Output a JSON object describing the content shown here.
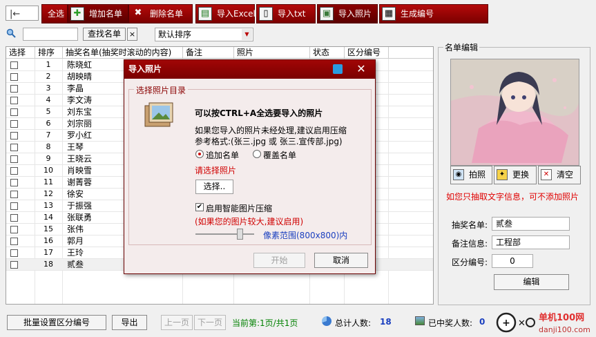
{
  "toolbar": {
    "select_all": "全选",
    "add_list": "增加名单",
    "delete_list": "删除名单",
    "import_excel": "导入Excel",
    "import_txt": "导入txt",
    "import_photo": "导入照片",
    "generate_number": "生成编号"
  },
  "search": {
    "button": "查找名单",
    "clear": "×",
    "sort": "默认排序"
  },
  "table": {
    "headers": [
      "选择",
      "排序",
      "抽奖名单(抽奖时滚动的内容)",
      "备注",
      "照片",
      "状态",
      "区分编号"
    ],
    "rows": [
      {
        "n": "1",
        "name": "陈晓虹"
      },
      {
        "n": "2",
        "name": "胡映晴"
      },
      {
        "n": "3",
        "name": "李晶"
      },
      {
        "n": "4",
        "name": "李文涛"
      },
      {
        "n": "5",
        "name": "刘东宝"
      },
      {
        "n": "6",
        "name": "刘宗丽"
      },
      {
        "n": "7",
        "name": "罗小红"
      },
      {
        "n": "8",
        "name": "王琴"
      },
      {
        "n": "9",
        "name": "王晓云"
      },
      {
        "n": "10",
        "name": "肖映雪"
      },
      {
        "n": "11",
        "name": "谢菁蓉"
      },
      {
        "n": "12",
        "name": "徐安"
      },
      {
        "n": "13",
        "name": "于振强"
      },
      {
        "n": "14",
        "name": "张联勇"
      },
      {
        "n": "15",
        "name": "张伟"
      },
      {
        "n": "16",
        "name": "郭月"
      },
      {
        "n": "17",
        "name": "王玲"
      },
      {
        "n": "18",
        "name": "贰叁"
      }
    ]
  },
  "panel": {
    "title": "名单编辑",
    "take_photo": "拍照",
    "replace": "更换",
    "clear": "清空",
    "note": "如您只抽取文字信息，可不添加照片",
    "name_label": "抽奖名单:",
    "name_value": "贰叁",
    "remark_label": "备注信息:",
    "remark_value": "工程部",
    "code_label": "区分编号:",
    "code_value": "0",
    "edit": "编辑"
  },
  "bottom": {
    "batch": "批量设置区分编号",
    "export": "导出",
    "prev": "上一页",
    "next": "下一页",
    "page": "当前第:1页/共1页",
    "total_label": "总计人数:",
    "total_value": "18",
    "winners_label": "已中奖人数:",
    "winners_value": "0"
  },
  "dialog": {
    "title": "导入照片",
    "group": "选择照片目录",
    "hint_bold": "可以按CTRL+A全选要导入的照片",
    "hint1": "如果您导入的照片未经处理,建议启用压缩",
    "hint2": "参考格式:(张三.jpg 或 张三.宣传部.jpg)",
    "opt_append": "追加名单",
    "opt_overwrite": "覆盖名单",
    "select_prompt": "请选择照片",
    "select_btn": "选择..",
    "compress_label": "启用智能图片压缩",
    "compress_note": "(如果您的图片较大,建议启用)",
    "pixel_range": "像素范围(800x800)内",
    "start": "开始",
    "cancel": "取消"
  },
  "watermark": {
    "brand": "单机100网",
    "url": "danji100.com"
  },
  "colors": {
    "toolbar_red": "#a10606",
    "dialog_title": "#8c0303",
    "note_red": "#e00000",
    "green": "#008000"
  }
}
